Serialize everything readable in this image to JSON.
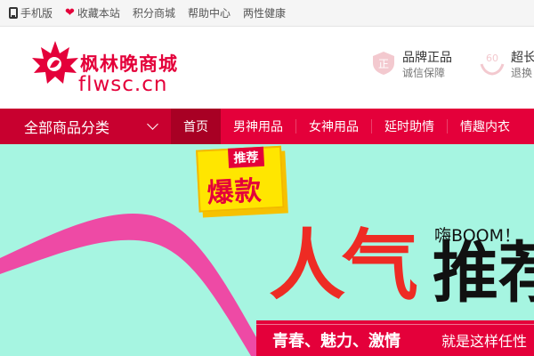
{
  "topbar": {
    "items": [
      {
        "label": "手机版",
        "icon": "phone-icon"
      },
      {
        "label": "收藏本站",
        "icon": "heart-icon"
      },
      {
        "label": "积分商城"
      },
      {
        "label": "帮助中心"
      },
      {
        "label": "两性健康"
      }
    ]
  },
  "header": {
    "logo_title": "枫林晚商城",
    "logo_domain": "flwsc.cn",
    "promises": [
      {
        "icon": "authentic-seal-icon",
        "title": "品牌正品",
        "subtitle": "诚信保障"
      },
      {
        "icon": "sixty-days-hands-icon",
        "title": "超长",
        "subtitle": "退换"
      }
    ]
  },
  "nav": {
    "all_categories": "全部商品分类",
    "items": [
      "首页",
      "男神用品",
      "女神用品",
      "延时助情",
      "情趣内衣"
    ],
    "active_index": 0
  },
  "banner": {
    "badge_top": "推荐",
    "badge_main": "爆款",
    "boom": "嗨BOOM！",
    "headline_red": "人气",
    "headline_black": "推荐",
    "ribbon_left": "青春、魅力、激情",
    "ribbon_right": "就是这样任性"
  },
  "colors": {
    "brand_red": "#e4003a",
    "banner_bg": "#a6f5e1",
    "badge_yellow": "#ffe600",
    "swoosh_pink": "#ee4aa5"
  }
}
